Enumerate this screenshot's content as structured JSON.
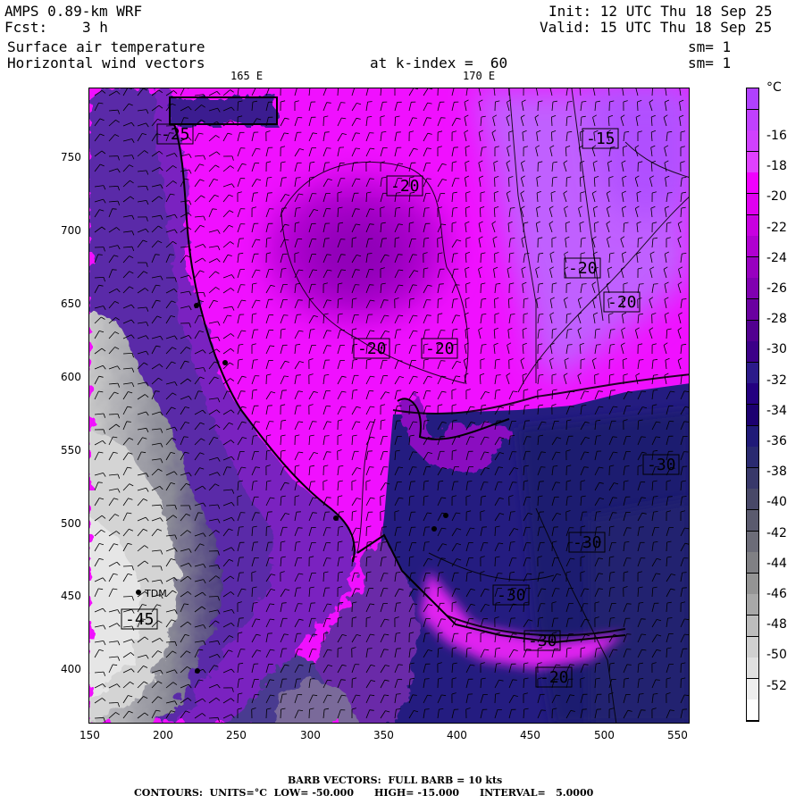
{
  "header": {
    "model": "AMPS 0.89-km WRF",
    "fcst_label": "Fcst:",
    "fcst_value": "3 h",
    "field1": "Surface air temperature",
    "field2": "Horizontal wind vectors",
    "level": "at k-index =  60",
    "init": "Init: 12 UTC Thu 18 Sep 25",
    "valid": "Valid: 15 UTC Thu 18 Sep 25",
    "sm1": "sm= 1",
    "sm2": "sm= 1"
  },
  "lon_labels": {
    "lon1": "165 E",
    "lon2": "170 E"
  },
  "axes": {
    "x_ticks": [
      "150",
      "200",
      "250",
      "300",
      "350",
      "400",
      "450",
      "500",
      "550"
    ],
    "y_ticks": [
      "750",
      "700",
      "650",
      "600",
      "550",
      "500",
      "450",
      "400"
    ]
  },
  "colorbar": {
    "unit": "°C",
    "labels": [
      "-16",
      "-18",
      "-20",
      "-22",
      "-24",
      "-26",
      "-28",
      "-30",
      "-32",
      "-34",
      "-36",
      "-38",
      "-40",
      "-42",
      "-44",
      "-46",
      "-48",
      "-50",
      "-52"
    ],
    "colors": [
      "#b040ff",
      "#c040ff",
      "#d040ff",
      "#e040ff",
      "#f000ff",
      "#e000f0",
      "#c800e0",
      "#b000d0",
      "#9800c0",
      "#8000b0",
      "#6a00a0",
      "#520090",
      "#3c0088",
      "#2c1a8a",
      "#240080",
      "#1c0070",
      "#201a78",
      "#2a2a70",
      "#38386a",
      "#484868",
      "#5a5a6e",
      "#6c6c78",
      "#808084",
      "#949494",
      "#a8a8a8",
      "#bcbcbc",
      "#d0d0d0",
      "#e0e0e0",
      "#eeeeee",
      "#ffffff"
    ]
  },
  "map_labels": [
    {
      "text": "-15"
    },
    {
      "text": "-20"
    },
    {
      "text": "-20"
    },
    {
      "text": "-20"
    },
    {
      "text": "-20"
    },
    {
      "text": "-20"
    },
    {
      "text": "-30"
    },
    {
      "text": "-30"
    },
    {
      "text": "-30"
    },
    {
      "text": "-30"
    },
    {
      "text": "-20"
    },
    {
      "text": "-45"
    },
    {
      "text": "-25"
    }
  ],
  "station_label": "TDM",
  "footer": {
    "barb": "BARB VECTORS:  FULL BARB = 10 kts",
    "contours": "CONTOURS:  UNITS=°C  LOW= -50.000      HIGH= -15.000      INTERVAL=   5.0000"
  }
}
